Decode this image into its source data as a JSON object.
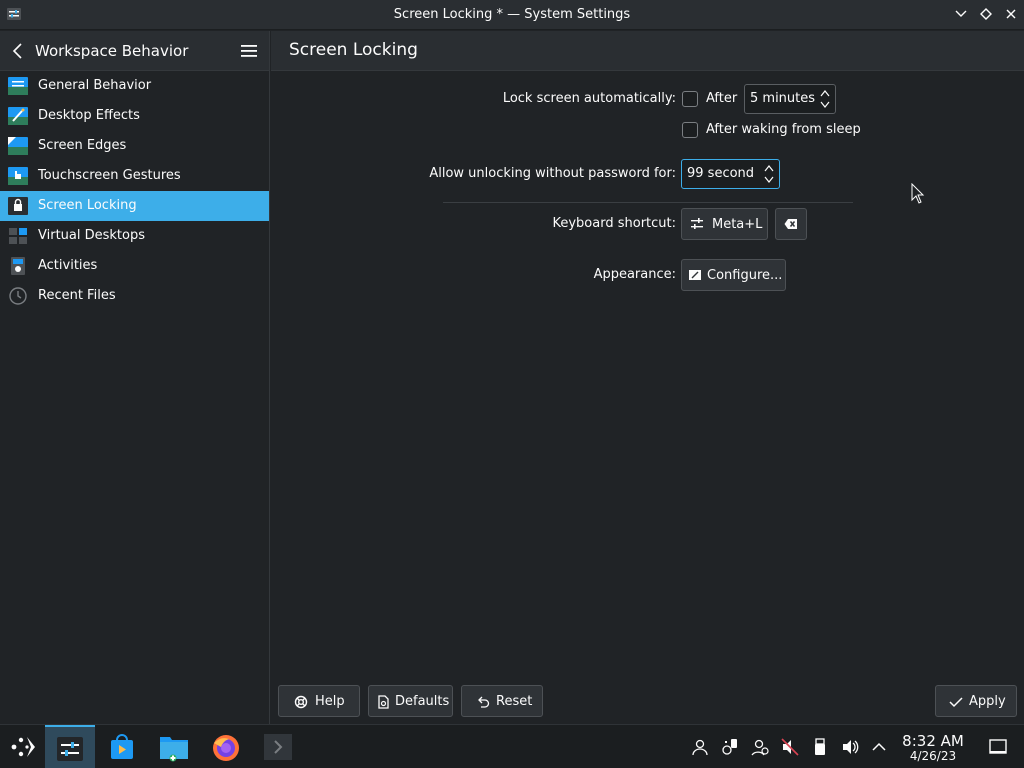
{
  "window": {
    "title": "Screen Locking * — System Settings",
    "app_icon": "system-settings-icon",
    "buttons": [
      "minimize-icon",
      "maximize-icon",
      "close-icon"
    ]
  },
  "sidebar": {
    "title": "Workspace Behavior",
    "items": [
      {
        "label": "General Behavior",
        "icon": "general-behavior-icon"
      },
      {
        "label": "Desktop Effects",
        "icon": "desktop-effects-icon"
      },
      {
        "label": "Screen Edges",
        "icon": "screen-edges-icon"
      },
      {
        "label": "Touchscreen Gestures",
        "icon": "touchscreen-gestures-icon"
      },
      {
        "label": "Screen Locking",
        "icon": "screen-locking-icon",
        "active": true
      },
      {
        "label": "Virtual Desktops",
        "icon": "virtual-desktops-icon"
      },
      {
        "label": "Activities",
        "icon": "activities-icon"
      },
      {
        "label": "Recent Files",
        "icon": "recent-files-icon"
      }
    ]
  },
  "page": {
    "title": "Screen Locking",
    "lock_auto_label": "Lock screen automatically:",
    "after_label": "After",
    "after_value": "5 minutes",
    "after_waking_label": "After waking from sleep",
    "allow_unlock_label": "Allow unlocking without password for:",
    "allow_unlock_value": "99 second",
    "shortcut_label": "Keyboard shortcut:",
    "shortcut_value": "Meta+L",
    "appearance_label": "Appearance:",
    "configure_label": "Configure..."
  },
  "footer": {
    "help": "Help",
    "defaults": "Defaults",
    "reset": "Reset",
    "apply": "Apply"
  },
  "taskbar": {
    "time": "8:32 AM",
    "date": "4/26/23",
    "apps": [
      "application-launcher-icon",
      "system-settings-icon",
      "discover-icon",
      "dolphin-icon",
      "firefox-icon",
      "konsole-icon"
    ],
    "tray": [
      "user-icon",
      "kde-connect-icon",
      "account-icon",
      "volume-muted-icon",
      "usb-icon",
      "volume-icon",
      "show-hidden-icon",
      "show-desktop-icon"
    ]
  },
  "colors": {
    "accent": "#3daee9",
    "background": "#202326",
    "header": "#2a2e32"
  }
}
